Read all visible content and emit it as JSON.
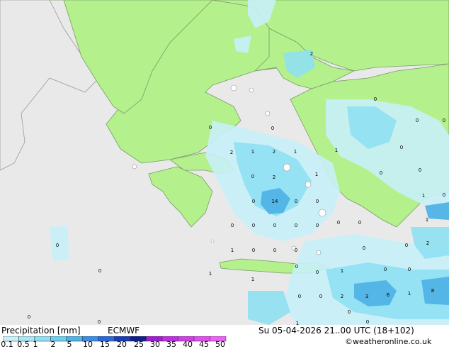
{
  "footer": {
    "title": "Precipitation [mm]",
    "model": "ECMWF",
    "datetime": "Su 05-04-2026 21..00 UTC (18+102)",
    "credit": "©weatheronline.co.uk"
  },
  "legend": {
    "labels": [
      "0.1",
      "0.5",
      "1",
      "2",
      "5",
      "10",
      "15",
      "20",
      "25",
      "30",
      "35",
      "40",
      "45",
      "50"
    ],
    "colors": [
      "#c8f0f8",
      "#a8e8f6",
      "#8ee0f2",
      "#6ccfec",
      "#4fb3e6",
      "#3c8ee4",
      "#2a68d8",
      "#1a3cb8",
      "#10208a",
      "#a020d0",
      "#c030e0",
      "#d040e8",
      "#e050f0",
      "#f060f8"
    ]
  },
  "map_values": [
    "2",
    "0",
    "0",
    "0",
    "0",
    "0",
    "2",
    "1",
    "2",
    "1",
    "1",
    "2",
    "0",
    "1",
    "14",
    "0",
    "0",
    "0",
    "0",
    "0",
    "0",
    "0",
    "0",
    "0",
    "0",
    "1",
    "0",
    "0",
    "0",
    "0",
    "1",
    "1",
    "0",
    "0",
    "0",
    "0",
    "0",
    "1",
    "1",
    "2",
    "0",
    "0",
    "0",
    "0",
    "2",
    "0",
    "0",
    "1",
    "3",
    "6",
    "1",
    "8",
    "0",
    "0",
    "1",
    "0",
    "0",
    "0",
    "0"
  ],
  "colors": {
    "land": "#b4f08c",
    "sea": "#e9e9e9",
    "rain_light": "#c8f0f8",
    "rain_mid": "#8ee0f2",
    "rain_heavy": "#4fb3e6"
  }
}
